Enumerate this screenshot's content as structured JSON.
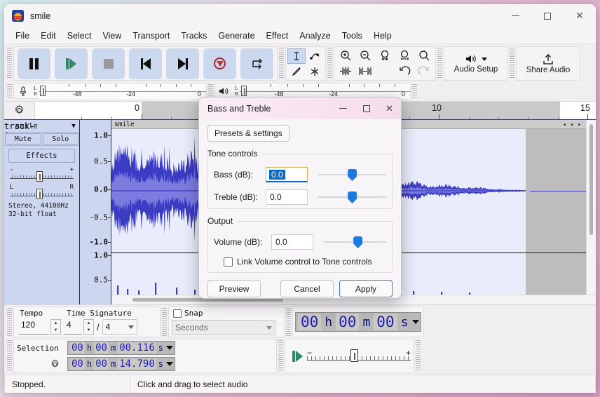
{
  "app": {
    "title": "smile",
    "icon": "audacity-logo-icon",
    "window_buttons": {
      "minimize": "minimize-icon",
      "maximize": "maximize-icon",
      "close": "close-icon"
    }
  },
  "menubar": {
    "items": [
      "File",
      "Edit",
      "Select",
      "View",
      "Transport",
      "Tracks",
      "Generate",
      "Effect",
      "Analyze",
      "Tools",
      "Help"
    ]
  },
  "transport": {
    "buttons": [
      {
        "name": "pause-button",
        "icon": "pause-icon"
      },
      {
        "name": "play-button",
        "icon": "play-icon"
      },
      {
        "name": "stop-button",
        "icon": "stop-icon"
      },
      {
        "name": "skip-to-start-button",
        "icon": "skip-start-icon"
      },
      {
        "name": "skip-to-end-button",
        "icon": "skip-end-icon"
      },
      {
        "name": "record-button",
        "icon": "record-icon"
      },
      {
        "name": "loop-button",
        "icon": "loop-icon"
      }
    ]
  },
  "tools": {
    "selection": "selection-tool-icon",
    "envelope": "envelope-tool-icon",
    "draw": "draw-tool-icon",
    "multi": "multi-tool-icon"
  },
  "edit_toolbar": {
    "zoom_in": "zoom-in-icon",
    "zoom_out": "zoom-out-icon",
    "fit_selection": "fit-selection-icon",
    "fit_project": "fit-project-icon",
    "zoom_toggle": "zoom-toggle-icon",
    "trim_outside": "trim-outside-selection-icon",
    "silence_selection": "silence-selection-icon",
    "undo": "undo-icon",
    "redo": "redo-icon"
  },
  "audio_setup": {
    "label": "Audio Setup",
    "icon": "speaker-icon",
    "caret": "chevron-down-icon"
  },
  "share_audio": {
    "label": "Share Audio",
    "icon": "upload-icon"
  },
  "meters": {
    "record": {
      "icon": "microphone-icon",
      "channels": "L\nR",
      "ticks": [
        "-48",
        "-24",
        "0"
      ]
    },
    "play": {
      "icon": "speaker-icon",
      "channels": "L\nR",
      "ticks": [
        "-48",
        "-24",
        "0"
      ]
    }
  },
  "timeline": {
    "gear": "timeline-options-gear-icon",
    "labels": [
      "0",
      "10",
      "15"
    ]
  },
  "track": {
    "close": "close-track-icon",
    "name": "smile",
    "menu_caret": "track-menu-chevron-icon",
    "mute": "Mute",
    "solo": "Solo",
    "effects": "Effects",
    "gain_minus": "-",
    "gain_plus": "+",
    "pan_left": "L",
    "pan_right": "R",
    "info_line1": "Stereo, 44100Hz",
    "info_line2": "32-bit float",
    "vruler": [
      "1.0",
      "0.5",
      "0.0",
      "-0.5",
      "-1.0",
      "1.0",
      "0.5"
    ],
    "clip_title": "smile",
    "clip_menu": "• • •",
    "waveform_color": "#3b3bc4",
    "background_color": "#e9edfb"
  },
  "dialog": {
    "title": "Bass and Treble",
    "window_buttons": {
      "minimize": "minimize-icon",
      "maximize": "maximize-icon",
      "close": "close-icon"
    },
    "presets_button": "Presets & settings",
    "tone_group": "Tone controls",
    "bass": {
      "label": "Bass (dB):",
      "value": "0.0",
      "slider_percent": 50
    },
    "treble": {
      "label": "Treble (dB):",
      "value": "0.0",
      "slider_percent": 50
    },
    "output_group": "Output",
    "volume": {
      "label": "Volume (dB):",
      "value": "0.0",
      "slider_percent": 50
    },
    "link_checkbox": {
      "label": "Link Volume control to Tone controls",
      "checked": false
    },
    "buttons": {
      "preview": "Preview",
      "cancel": "Cancel",
      "apply": "Apply"
    },
    "accent_color": "#1a7ae0",
    "titlebar_color": "#f8e3ef"
  },
  "bottom_toolbars": {
    "time_signature": {
      "tempo_label": "Tempo",
      "signature_label": "Time Signature",
      "tempo_value": "120",
      "upper_value": "4",
      "slash": "/",
      "lower_value": "4"
    },
    "snap": {
      "label": "Snap",
      "checked": false,
      "dropdown_value": "Seconds"
    },
    "audio_position": {
      "digits": [
        "00",
        "h",
        "00",
        "m",
        "00",
        "s"
      ]
    },
    "selection": {
      "label": "Selection",
      "gear": "selection-options-gear-icon",
      "start": [
        "00",
        "h",
        "00",
        "m",
        "00.116",
        "s"
      ],
      "end": [
        "00",
        "h",
        "00",
        "m",
        "14.790",
        "s"
      ]
    },
    "play_speed": {
      "play_icon": "play-at-speed-icon",
      "minus": "−",
      "plus": "+"
    }
  },
  "statusbar": {
    "state": "Stopped.",
    "hint": "Click and drag to select audio"
  }
}
